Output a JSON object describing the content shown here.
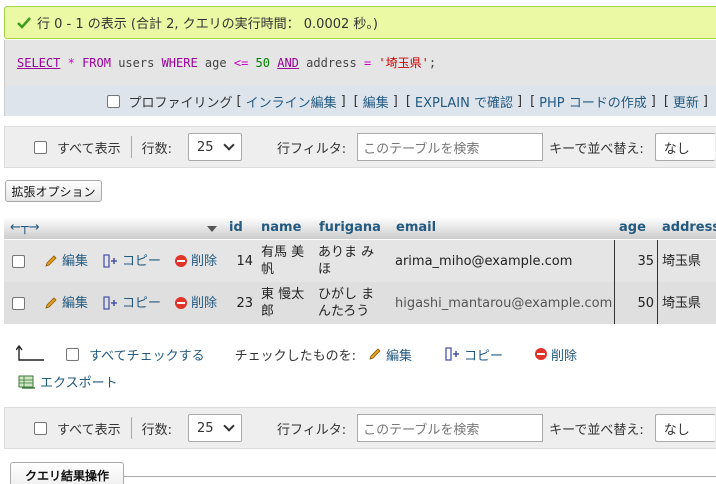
{
  "message": {
    "text": "行 0 - 1 の表示 (合計 2, クエリの実行時間： 0.0002 秒。)"
  },
  "sql": {
    "select": "SELECT",
    "star": "*",
    "from": "FROM",
    "table": "users",
    "where": "WHERE",
    "col1": "age",
    "op1": "<=",
    "num": "50",
    "and": "AND",
    "col2": "address",
    "op2": "=",
    "str": "'埼玉県'",
    "semi": ";"
  },
  "toolbar": {
    "profiling": "プロファイリング",
    "inline_edit": "インライン編集",
    "edit": "編集",
    "explain": "EXPLAIN で確認",
    "php": "PHP コードの作成",
    "refresh": "更新"
  },
  "nav": {
    "show_all": "すべて表示",
    "rows_label": "行数:",
    "rows_value": "25",
    "filter_label": "行フィルタ:",
    "filter_placeholder": "このテーブルを検索",
    "sort_label": "キーで並べ替え:",
    "sort_value": "なし"
  },
  "extend_options": "拡張オプション",
  "table": {
    "columns": [
      "id",
      "name",
      "furigana",
      "email",
      "age",
      "address"
    ],
    "actions": {
      "edit": "編集",
      "copy": "コピー",
      "delete": "削除"
    },
    "rows": [
      {
        "id": "14",
        "name1": "有馬 美",
        "name2": "帆",
        "furi1": "ありま み",
        "furi2": "ほ",
        "email": "arima_miho@example.com",
        "age": "35",
        "address": "埼玉県"
      },
      {
        "id": "23",
        "name1": "東 慢太",
        "name2": "郎",
        "furi1": "ひがし ま",
        "furi2": "んたろう",
        "email": "higashi_mantarou@example.com",
        "age": "50",
        "address": "埼玉県"
      }
    ]
  },
  "bulk": {
    "check_all": "すべてチェックする",
    "with_selected": "チェックしたものを:",
    "edit": "編集",
    "copy": "コピー",
    "delete": "削除"
  },
  "export": "エクスポート",
  "query_ops": "クエリ結果操作"
}
